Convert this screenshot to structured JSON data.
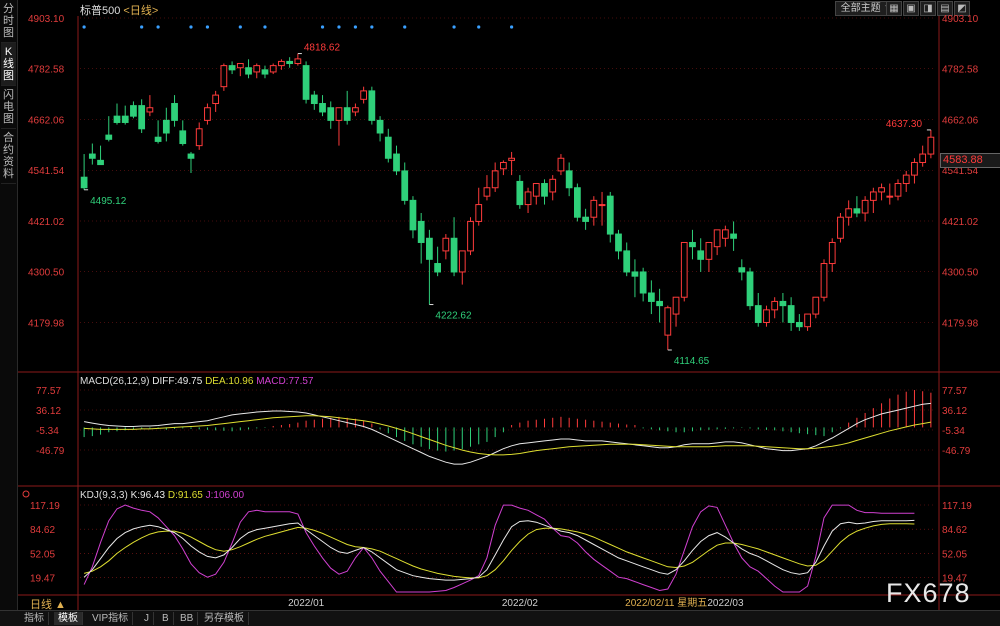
{
  "sidebar": {
    "tabs": [
      "分时图",
      "K线图",
      "闪电图",
      "合约资料"
    ],
    "active": 1
  },
  "header": {
    "title": "标普500",
    "period": "<日线>",
    "theme_button": "全部主题 ▼",
    "window_buttons": [
      "▦",
      "▣",
      "◨",
      "▤",
      "◩"
    ]
  },
  "colors": {
    "up": "#ff3b3b",
    "down": "#2fd07a",
    "grid": "#8b1a1a",
    "axis_label": "#e03c3c",
    "dif": "#e8e8e8",
    "dea": "#dede30",
    "macd": "#d040d0",
    "kdj_k": "#e8e8e8",
    "kdj_d": "#dede30",
    "kdj_j": "#d040d0",
    "date_highlight": "#e0b050"
  },
  "chart_data": [
    {
      "type": "candlestick",
      "title": "标普500 <日线>",
      "y_ticks": [
        "4903.10",
        "4782.58",
        "4662.06",
        "4541.54",
        "4421.02",
        "4300.50",
        "4179.98"
      ],
      "ylim": [
        4114.65,
        4903.1
      ],
      "annotations": [
        {
          "label": "4818.62",
          "index": 26,
          "value": 4818.62,
          "kind": "high"
        },
        {
          "label": "4495.12",
          "index": 0,
          "value": 4495.12,
          "kind": "low"
        },
        {
          "label": "4222.62",
          "index": 42,
          "value": 4222.62,
          "kind": "low"
        },
        {
          "label": "4114.65",
          "index": 71,
          "value": 4114.65,
          "kind": "low"
        },
        {
          "label": "4637.30",
          "index": 103,
          "value": 4637.3,
          "kind": "high"
        }
      ],
      "last_price": "4583.88",
      "x_labels": [
        "2022/01",
        "2022/02",
        "2022/02/11 星期五",
        "2022/03"
      ],
      "x_label_index": [
        27,
        53,
        68,
        78
      ],
      "signal_dot_index": [
        0,
        7,
        9,
        13,
        15,
        19,
        22,
        29,
        31,
        33,
        35,
        39,
        45,
        48,
        52
      ],
      "candles": [
        [
          4525,
          4580,
          4500,
          4495
        ],
        [
          4580,
          4605,
          4570,
          4555
        ],
        [
          4565,
          4600,
          4555,
          4560
        ],
        [
          4625,
          4670,
          4615,
          4610
        ],
        [
          4670,
          4700,
          4655,
          4650
        ],
        [
          4670,
          4695,
          4655,
          4650
        ],
        [
          4695,
          4705,
          4670,
          4665
        ],
        [
          4695,
          4710,
          4640,
          4630
        ],
        [
          4680,
          4720,
          4690,
          4670
        ],
        [
          4620,
          4660,
          4610,
          4605
        ],
        [
          4660,
          4690,
          4630,
          4610
        ],
        [
          4700,
          4720,
          4660,
          4645
        ],
        [
          4635,
          4660,
          4605,
          4600
        ],
        [
          4580,
          4585,
          4570,
          4535
        ],
        [
          4600,
          4655,
          4640,
          4590
        ],
        [
          4660,
          4700,
          4690,
          4650
        ],
        [
          4700,
          4730,
          4720,
          4680
        ],
        [
          4740,
          4795,
          4790,
          4730
        ],
        [
          4790,
          4800,
          4780,
          4770
        ],
        [
          4785,
          4795,
          4795,
          4765
        ],
        [
          4785,
          4805,
          4770,
          4760
        ],
        [
          4775,
          4795,
          4790,
          4760
        ],
        [
          4780,
          4790,
          4770,
          4760
        ],
        [
          4775,
          4795,
          4790,
          4770
        ],
        [
          4790,
          4805,
          4800,
          4780
        ],
        [
          4800,
          4810,
          4795,
          4785
        ],
        [
          4795,
          4818.62,
          4806,
          4790
        ],
        [
          4790,
          4800,
          4710,
          4700
        ],
        [
          4720,
          4730,
          4700,
          4685
        ],
        [
          4700,
          4720,
          4680,
          4670
        ],
        [
          4690,
          4705,
          4660,
          4640
        ],
        [
          4660,
          4690,
          4690,
          4600
        ],
        [
          4690,
          4730,
          4660,
          4650
        ],
        [
          4680,
          4700,
          4690,
          4670
        ],
        [
          4710,
          4740,
          4730,
          4700
        ],
        [
          4730,
          4740,
          4660,
          4650
        ],
        [
          4660,
          4670,
          4630,
          4610
        ],
        [
          4620,
          4640,
          4570,
          4560
        ],
        [
          4580,
          4600,
          4540,
          4530
        ],
        [
          4540,
          4560,
          4470,
          4460
        ],
        [
          4470,
          4480,
          4400,
          4380
        ],
        [
          4420,
          4440,
          4370,
          4320
        ],
        [
          4380,
          4400,
          4330,
          4222.62
        ],
        [
          4320,
          4360,
          4300,
          4290
        ],
        [
          4350,
          4390,
          4380,
          4330
        ],
        [
          4380,
          4430,
          4300,
          4290
        ],
        [
          4300,
          4330,
          4350,
          4270
        ],
        [
          4350,
          4430,
          4420,
          4340
        ],
        [
          4420,
          4500,
          4460,
          4410
        ],
        [
          4480,
          4530,
          4500,
          4470
        ],
        [
          4500,
          4560,
          4540,
          4490
        ],
        [
          4545,
          4565,
          4560,
          4530
        ],
        [
          4565,
          4585,
          4570,
          4530
        ],
        [
          4515,
          4530,
          4460,
          4450
        ],
        [
          4460,
          4500,
          4490,
          4440
        ],
        [
          4480,
          4510,
          4510,
          4460
        ],
        [
          4510,
          4520,
          4480,
          4460
        ],
        [
          4490,
          4530,
          4520,
          4470
        ],
        [
          4540,
          4580,
          4570,
          4530
        ],
        [
          4540,
          4560,
          4500,
          4480
        ],
        [
          4500,
          4510,
          4430,
          4420
        ],
        [
          4430,
          4450,
          4420,
          4400
        ],
        [
          4430,
          4480,
          4470,
          4410
        ],
        [
          4460,
          4490,
          4460,
          4410
        ],
        [
          4480,
          4490,
          4390,
          4370
        ],
        [
          4390,
          4400,
          4350,
          4330
        ],
        [
          4350,
          4370,
          4300,
          4290
        ],
        [
          4300,
          4330,
          4290,
          4240
        ],
        [
          4300,
          4310,
          4250,
          4230
        ],
        [
          4250,
          4280,
          4230,
          4200
        ],
        [
          4230,
          4260,
          4220,
          4180
        ],
        [
          4150,
          4220,
          4215,
          4114.65
        ],
        [
          4200,
          4240,
          4240,
          4170
        ],
        [
          4240,
          4300,
          4370,
          4230
        ],
        [
          4370,
          4400,
          4360,
          4330
        ],
        [
          4350,
          4380,
          4330,
          4300
        ],
        [
          4330,
          4350,
          4370,
          4300
        ],
        [
          4360,
          4400,
          4400,
          4340
        ],
        [
          4380,
          4410,
          4400,
          4360
        ],
        [
          4390,
          4420,
          4380,
          4350
        ],
        [
          4310,
          4330,
          4300,
          4280
        ],
        [
          4300,
          4310,
          4220,
          4210
        ],
        [
          4220,
          4250,
          4180,
          4170
        ],
        [
          4180,
          4220,
          4210,
          4170
        ],
        [
          4210,
          4240,
          4230,
          4190
        ],
        [
          4230,
          4250,
          4220,
          4180
        ],
        [
          4220,
          4240,
          4180,
          4160
        ],
        [
          4180,
          4200,
          4170,
          4160
        ],
        [
          4170,
          4200,
          4200,
          4160
        ],
        [
          4200,
          4240,
          4240,
          4190
        ],
        [
          4240,
          4330,
          4320,
          4230
        ],
        [
          4320,
          4380,
          4370,
          4300
        ],
        [
          4380,
          4440,
          4430,
          4370
        ],
        [
          4430,
          4470,
          4450,
          4410
        ],
        [
          4450,
          4480,
          4440,
          4430
        ],
        [
          4440,
          4480,
          4470,
          4420
        ],
        [
          4470,
          4500,
          4490,
          4440
        ],
        [
          4490,
          4510,
          4500,
          4470
        ],
        [
          4480,
          4510,
          4480,
          4460
        ],
        [
          4480,
          4520,
          4510,
          4470
        ],
        [
          4510,
          4540,
          4530,
          4490
        ],
        [
          4530,
          4570,
          4560,
          4510
        ],
        [
          4560,
          4600,
          4580,
          4550
        ],
        [
          4580,
          4637.3,
          4620,
          4570
        ]
      ]
    },
    {
      "type": "macd",
      "title": "MACD(26,12,9)",
      "legend": [
        {
          "name": "DIFF",
          "value": "49.75"
        },
        {
          "name": "DEA",
          "value": "10.96"
        },
        {
          "name": "MACD",
          "value": "77.57"
        }
      ],
      "y_ticks": [
        "77.57",
        "36.12",
        "-5.34",
        "-46.79"
      ],
      "ylim": [
        -88.25,
        77.57
      ],
      "hist": [
        -20,
        -18,
        -15,
        -10,
        -8,
        -6,
        -4,
        -3,
        -2,
        -3,
        -5,
        -3,
        -2,
        -3,
        -4,
        -5,
        -6,
        -7,
        -8,
        -6,
        -4,
        -2,
        -1,
        3,
        5,
        7,
        10,
        14,
        16,
        18,
        20,
        22,
        20,
        18,
        14,
        8,
        -4,
        -12,
        -20,
        -28,
        -35,
        -40,
        -45,
        -48,
        -50,
        -48,
        -45,
        -40,
        -35,
        -30,
        -20,
        -10,
        5,
        10,
        14,
        16,
        18,
        20,
        22,
        20,
        18,
        16,
        14,
        12,
        10,
        8,
        6,
        5,
        -2,
        -4,
        -6,
        -8,
        -10,
        -10,
        -8,
        -6,
        -5,
        -4,
        -3,
        -2,
        -1,
        -2,
        -4,
        -5,
        -6,
        -8,
        -10,
        -12,
        -14,
        -16,
        -18,
        -10,
        -2,
        10,
        20,
        30,
        40,
        50,
        60,
        68,
        74,
        77.57,
        75,
        72
      ],
      "dif": [
        12,
        9,
        6,
        4,
        3,
        2,
        2,
        3,
        3,
        4,
        6,
        8,
        8,
        10,
        12,
        14,
        18,
        22,
        26,
        28,
        30,
        32,
        33,
        34,
        34,
        33,
        32,
        30,
        26,
        22,
        18,
        14,
        10,
        6,
        2,
        -4,
        -12,
        -20,
        -28,
        -36,
        -44,
        -52,
        -60,
        -66,
        -72,
        -76,
        -76,
        -72,
        -66,
        -60,
        -52,
        -44,
        -38,
        -34,
        -32,
        -30,
        -28,
        -26,
        -24,
        -24,
        -26,
        -28,
        -28,
        -28,
        -30,
        -32,
        -34,
        -36,
        -38,
        -40,
        -42,
        -42,
        -40,
        -36,
        -34,
        -34,
        -34,
        -32,
        -30,
        -30,
        -32,
        -36,
        -40,
        -44,
        -46,
        -48,
        -48,
        -46,
        -44,
        -38,
        -30,
        -22,
        -12,
        -2,
        8,
        16,
        22,
        28,
        32,
        36,
        40,
        44,
        48,
        49.75
      ],
      "dea": [
        -2,
        -3,
        -4,
        -4,
        -4,
        -4,
        -4,
        -3,
        -3,
        -2,
        -1,
        0,
        1,
        2,
        3,
        4,
        6,
        8,
        10,
        12,
        14,
        16,
        18,
        20,
        21,
        22,
        23,
        24,
        24,
        23,
        22,
        20,
        18,
        16,
        14,
        11,
        7,
        3,
        -2,
        -7,
        -13,
        -19,
        -25,
        -31,
        -37,
        -42,
        -47,
        -51,
        -54,
        -56,
        -57,
        -57,
        -56,
        -54,
        -51,
        -48,
        -46,
        -44,
        -42,
        -40,
        -39,
        -38,
        -37,
        -36,
        -35,
        -35,
        -35,
        -35,
        -36,
        -37,
        -38,
        -39,
        -40,
        -40,
        -40,
        -40,
        -40,
        -39,
        -38,
        -38,
        -38,
        -38,
        -39,
        -40,
        -41,
        -42,
        -43,
        -44,
        -44,
        -43,
        -41,
        -39,
        -36,
        -32,
        -27,
        -22,
        -17,
        -12,
        -7,
        -3,
        1,
        5,
        8,
        10.96
      ]
    },
    {
      "type": "kdj",
      "title": "KDJ(9,3,3)",
      "legend": [
        {
          "name": "K",
          "value": "96.43"
        },
        {
          "name": "D",
          "value": "91.65"
        },
        {
          "name": "J",
          "value": "106.00"
        }
      ],
      "y_ticks": [
        "117.19",
        "84.62",
        "52.05",
        "19.47"
      ],
      "ylim": [
        0,
        117.19
      ],
      "k": [
        20,
        30,
        45,
        60,
        72,
        80,
        85,
        88,
        90,
        88,
        84,
        80,
        72,
        62,
        54,
        48,
        46,
        50,
        60,
        72,
        80,
        84,
        86,
        88,
        90,
        92,
        93,
        84,
        76,
        68,
        60,
        54,
        52,
        56,
        60,
        54,
        46,
        38,
        30,
        26,
        22,
        20,
        18,
        17,
        16,
        16,
        17,
        18,
        20,
        30,
        50,
        70,
        88,
        95,
        96,
        94,
        90,
        86,
        82,
        80,
        76,
        70,
        64,
        58,
        52,
        46,
        42,
        38,
        34,
        30,
        26,
        24,
        30,
        42,
        56,
        68,
        76,
        80,
        74,
        66,
        58,
        52,
        48,
        42,
        36,
        30,
        26,
        24,
        26,
        40,
        62,
        82,
        92,
        94,
        92,
        93,
        95,
        96,
        96,
        96,
        96,
        96.43
      ],
      "d": [
        25,
        28,
        34,
        42,
        52,
        60,
        67,
        73,
        78,
        81,
        82,
        82,
        79,
        74,
        68,
        62,
        57,
        55,
        57,
        61,
        66,
        71,
        75,
        78,
        81,
        84,
        87,
        86,
        83,
        79,
        74,
        69,
        64,
        61,
        60,
        58,
        55,
        50,
        45,
        40,
        35,
        31,
        28,
        25,
        23,
        21,
        20,
        19,
        19,
        22,
        30,
        42,
        56,
        68,
        78,
        84,
        86,
        86,
        85,
        83,
        81,
        78,
        74,
        69,
        64,
        59,
        54,
        50,
        46,
        42,
        38,
        34,
        33,
        35,
        40,
        48,
        56,
        63,
        66,
        66,
        64,
        61,
        58,
        54,
        50,
        46,
        42,
        38,
        35,
        36,
        43,
        55,
        67,
        76,
        82,
        86,
        89,
        91,
        92,
        92,
        92,
        91.65
      ],
      "j": [
        10,
        34,
        67,
        96,
        112,
        117.19,
        113,
        110,
        108,
        100,
        88,
        76,
        58,
        38,
        26,
        20,
        24,
        40,
        66,
        94,
        108,
        110,
        108,
        108,
        108,
        108,
        105,
        80,
        62,
        46,
        32,
        24,
        28,
        46,
        60,
        46,
        28,
        14,
        0,
        0,
        0,
        0,
        0,
        1,
        2,
        6,
        11,
        16,
        22,
        46,
        90,
        117,
        117,
        113,
        110,
        104,
        98,
        86,
        76,
        74,
        66,
        54,
        44,
        36,
        28,
        20,
        18,
        14,
        10,
        6,
        2,
        4,
        24,
        56,
        88,
        108,
        116,
        114,
        90,
        66,
        46,
        34,
        28,
        18,
        8,
        0,
        0,
        0,
        8,
        48,
        100,
        117,
        117,
        117,
        110,
        107,
        107,
        106,
        106,
        106,
        106,
        106.0
      ]
    }
  ],
  "period_label": "日线 ▲",
  "bottom_tabs": [
    "指标",
    "模板",
    "VIP指标",
    "J",
    "B",
    "BB",
    "另存模板"
  ],
  "bottom_active": 1,
  "watermark": "FX678"
}
